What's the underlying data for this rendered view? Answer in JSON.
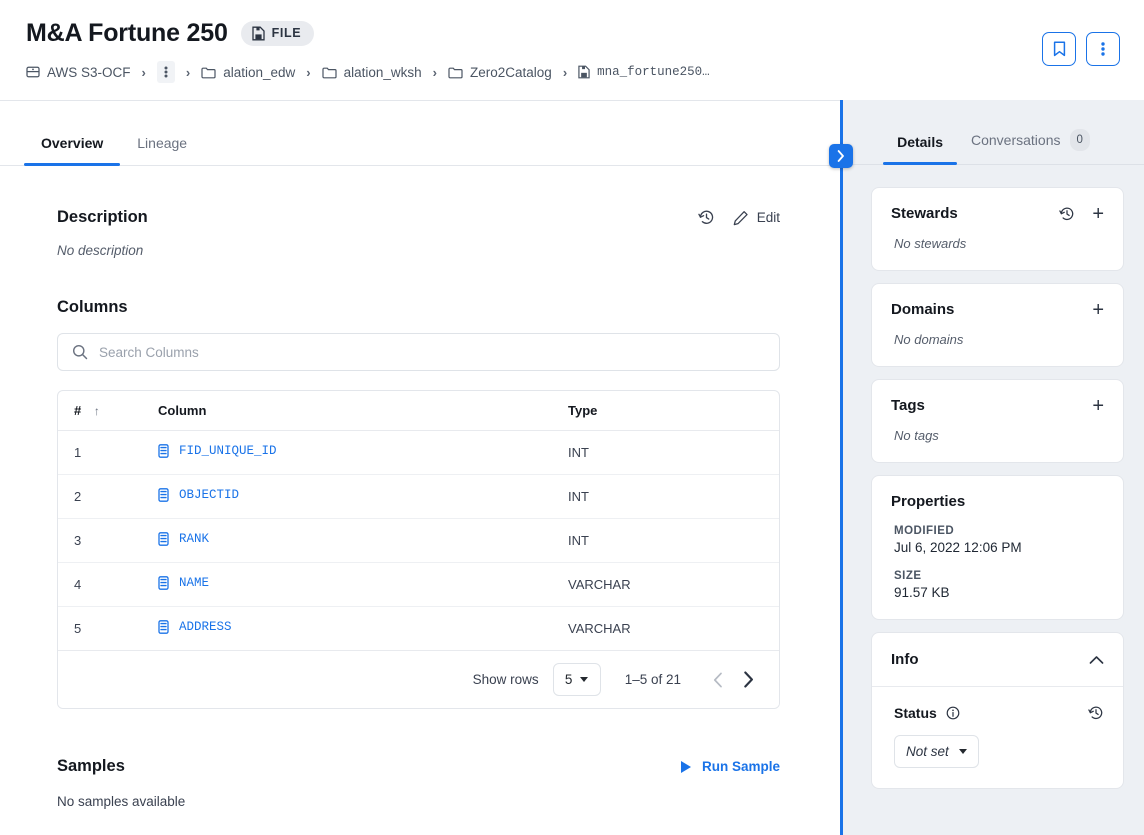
{
  "header": {
    "title": "M&A Fortune 250",
    "badge": {
      "label": "FILE",
      "icon": "file-icon"
    },
    "breadcrumb": [
      {
        "label": "AWS S3-OCF",
        "icon": "database-icon"
      },
      {
        "label": "",
        "icon": "more-vertical-icon"
      },
      {
        "label": "alation_edw",
        "icon": "folder-icon"
      },
      {
        "label": "alation_wksh",
        "icon": "folder-icon"
      },
      {
        "label": "Zero2Catalog",
        "icon": "folder-icon"
      },
      {
        "label": "mna_fortune250…",
        "icon": "file-icon"
      }
    ],
    "actions": [
      {
        "name": "bookmark-button",
        "icon": "bookmark-icon"
      },
      {
        "name": "more-options-button",
        "icon": "more-vertical-icon"
      }
    ]
  },
  "tabs": [
    {
      "label": "Overview",
      "active": true
    },
    {
      "label": "Lineage",
      "active": false
    }
  ],
  "description": {
    "title": "Description",
    "history_icon": "history-icon",
    "edit_label": "Edit",
    "edit_icon": "pencil-icon",
    "empty_text": "No description"
  },
  "columns": {
    "title": "Columns",
    "search_placeholder": "Search Columns",
    "search_value": "",
    "search_icon": "search-icon",
    "headers": {
      "num": "#",
      "column": "Column",
      "type": "Type"
    },
    "sort_icon": "arrow-up-icon",
    "rows": [
      {
        "num": "1",
        "name": "FID_UNIQUE_ID",
        "type": "INT"
      },
      {
        "num": "2",
        "name": "OBJECTID",
        "type": "INT"
      },
      {
        "num": "3",
        "name": "RANK",
        "type": "INT"
      },
      {
        "num": "4",
        "name": "NAME",
        "type": "VARCHAR"
      },
      {
        "num": "5",
        "name": "ADDRESS",
        "type": "VARCHAR"
      }
    ],
    "pager": {
      "show_rows_label": "Show rows",
      "rows_per_page": "5",
      "range": "1–5 of 21",
      "prev_icon": "chevron-left-icon",
      "next_icon": "chevron-right-icon"
    }
  },
  "samples": {
    "title": "Samples",
    "run_label": "Run Sample",
    "run_icon": "play-icon",
    "empty_text": "No samples available"
  },
  "sidebar": {
    "collapse_icon": "chevron-right-icon",
    "tabs": [
      {
        "label": "Details",
        "active": true,
        "count": null
      },
      {
        "label": "Conversations",
        "active": false,
        "count": "0"
      }
    ],
    "cards": [
      {
        "title": "Stewards",
        "empty_text": "No stewards",
        "has_history": true,
        "has_add": true
      },
      {
        "title": "Domains",
        "empty_text": "No domains",
        "has_history": false,
        "has_add": true
      },
      {
        "title": "Tags",
        "empty_text": "No tags",
        "has_history": false,
        "has_add": true
      }
    ],
    "properties": {
      "title": "Properties",
      "fields": [
        {
          "label": "MODIFIED",
          "value": "Jul 6, 2022 12:06 PM"
        },
        {
          "label": "SIZE",
          "value": "91.57 KB"
        }
      ]
    },
    "info": {
      "title": "Info",
      "collapse_icon": "chevron-up-icon",
      "status": {
        "label": "Status",
        "info_icon": "info-circle-icon",
        "history_icon": "history-icon",
        "value": "Not set"
      }
    }
  },
  "colors": {
    "accent": "#1a73e8",
    "sidebar_bg": "#edf0f4",
    "text": "#14181f",
    "muted": "#6b7280"
  }
}
